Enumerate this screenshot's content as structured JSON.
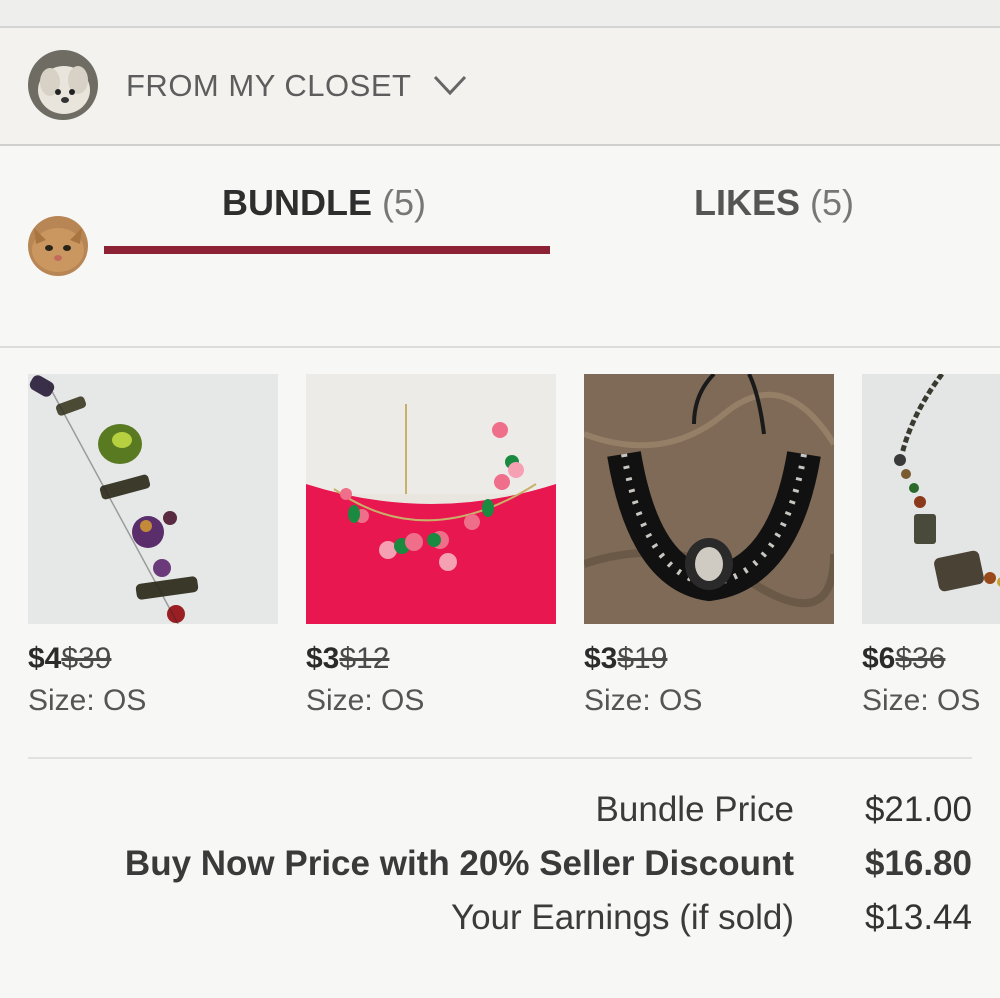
{
  "header": {
    "closet_label": "FROM MY CLOSET"
  },
  "tabs": [
    {
      "name": "BUNDLE",
      "count": "(5)"
    },
    {
      "name": "LIKES",
      "count": "(5)"
    }
  ],
  "products": [
    {
      "price": "$4",
      "original_price": "$39",
      "size": "Size: OS"
    },
    {
      "price": "$3",
      "original_price": "$12",
      "size": "Size: OS"
    },
    {
      "price": "$3",
      "original_price": "$19",
      "size": "Size: OS"
    },
    {
      "price": "$6",
      "original_price": "$36",
      "size": "Size: OS"
    }
  ],
  "summary": {
    "bundle_price_label": "Bundle Price",
    "bundle_price": "$21.00",
    "buy_now_label": "Buy Now Price with 20% Seller Discount",
    "buy_now_price": "$16.80",
    "earnings_label": "Your Earnings (if sold)",
    "earnings": "$13.44"
  },
  "colors": {
    "accent": "#8c2234",
    "background": "#f7f7f6",
    "header_bg": "#f3f2ef"
  }
}
